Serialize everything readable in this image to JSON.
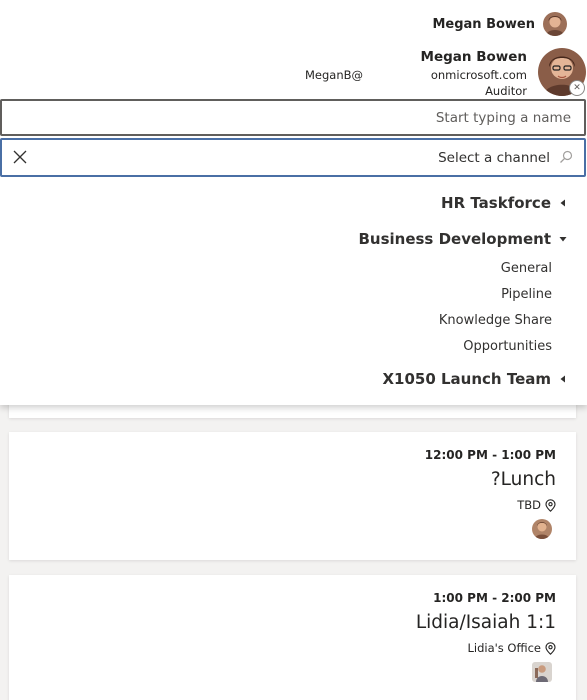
{
  "header": {
    "user_name": "Megan Bowen"
  },
  "persona": {
    "alias": "MeganB@",
    "name": "Megan Bowen",
    "domain": "onmicrosoft.com",
    "role": "Auditor"
  },
  "people_picker": {
    "placeholder": "Start typing a name"
  },
  "channel_picker": {
    "value": "Select a channel",
    "clear_icon": "close-icon",
    "search_icon": "search-icon"
  },
  "teams": [
    {
      "name": "HR Taskforce",
      "expanded": false
    },
    {
      "name": "Business Development",
      "expanded": true,
      "channels": [
        "General",
        "Pipeline",
        "Knowledge Share",
        "Opportunities"
      ]
    },
    {
      "name": "X1050 Launch Team",
      "expanded": false
    }
  ],
  "meetings": [
    {
      "time": "12:00 PM - 1:00 PM",
      "title": "?Lunch",
      "location": "TBD"
    },
    {
      "time": "1:00 PM - 2:00 PM",
      "title": "Lidia/Isaiah 1:1",
      "location": "Lidia's Office"
    }
  ],
  "colors": {
    "focus_border": "#4a6fa5",
    "input_border": "#605e5c",
    "text": "#323130",
    "background": "#f3f2f1"
  }
}
